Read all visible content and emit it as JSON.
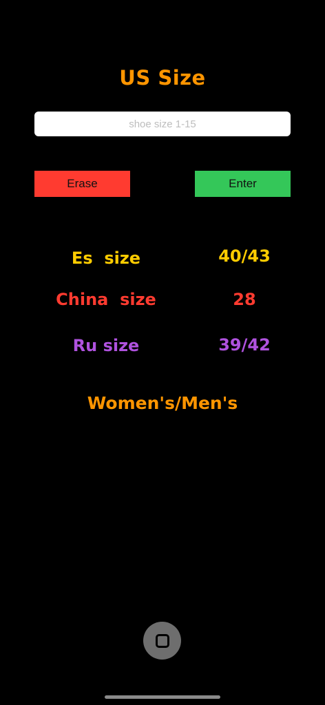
{
  "header": {
    "title": "US Size"
  },
  "input": {
    "placeholder": "shoe size 1-15",
    "value": ""
  },
  "buttons": {
    "erase_label": "Erase",
    "enter_label": "Enter"
  },
  "results": [
    {
      "label": "Es  size",
      "value": "40/43",
      "color": "#FFCC00"
    },
    {
      "label": "China  size",
      "value": "28",
      "color": "#FF3B30"
    },
    {
      "label": "Ru size",
      "value": "39/42",
      "color": "#AF52DE"
    }
  ],
  "footer": {
    "label": "Women's/Men's",
    "color": "#FF9500"
  },
  "colors": {
    "background": "#000000",
    "title": "#FF9500",
    "erase_button": "#FF3B30",
    "enter_button": "#34C759"
  },
  "system": {
    "home_button_icon": "square-icon"
  }
}
